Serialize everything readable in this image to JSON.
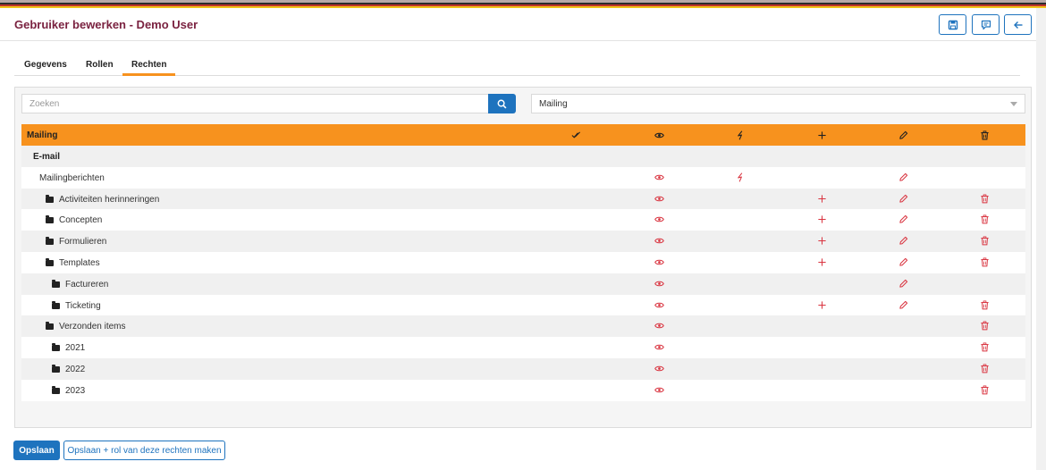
{
  "header": {
    "title": "Gebruiker bewerken - Demo User",
    "buttons": [
      {
        "icon": "save-icon"
      },
      {
        "icon": "comment-icon"
      },
      {
        "icon": "arrow-left-icon"
      }
    ]
  },
  "tabs": [
    {
      "label": "Gegevens",
      "active": false
    },
    {
      "label": "Rollen",
      "active": false
    },
    {
      "label": "Rechten",
      "active": true
    }
  ],
  "search": {
    "placeholder": "Zoeken",
    "value": ""
  },
  "filter_select": {
    "value": "Mailing"
  },
  "table": {
    "header_label": "Mailing",
    "header_icons": [
      "check-double-icon",
      "eye-icon",
      "lightning-icon",
      "plus-icon",
      "pencil-icon",
      "trash-icon"
    ],
    "section_label": "E-mail",
    "rows": [
      {
        "label": "Mailingberichten",
        "indent": 0,
        "folder": false,
        "eye": true,
        "lightning": true,
        "plus": false,
        "pencil": true,
        "trash": false
      },
      {
        "label": "Activiteiten herinneringen",
        "indent": 1,
        "folder": true,
        "eye": true,
        "lightning": false,
        "plus": true,
        "pencil": true,
        "trash": true
      },
      {
        "label": "Concepten",
        "indent": 1,
        "folder": true,
        "eye": true,
        "lightning": false,
        "plus": true,
        "pencil": true,
        "trash": true
      },
      {
        "label": "Formulieren",
        "indent": 1,
        "folder": true,
        "eye": true,
        "lightning": false,
        "plus": true,
        "pencil": true,
        "trash": true
      },
      {
        "label": "Templates",
        "indent": 1,
        "folder": true,
        "eye": true,
        "lightning": false,
        "plus": true,
        "pencil": true,
        "trash": true
      },
      {
        "label": "Factureren",
        "indent": 2,
        "folder": true,
        "eye": true,
        "lightning": false,
        "plus": false,
        "pencil": true,
        "trash": false
      },
      {
        "label": "Ticketing",
        "indent": 2,
        "folder": true,
        "eye": true,
        "lightning": false,
        "plus": true,
        "pencil": true,
        "trash": true
      },
      {
        "label": "Verzonden items",
        "indent": 1,
        "folder": true,
        "eye": true,
        "lightning": false,
        "plus": false,
        "pencil": false,
        "trash": true
      },
      {
        "label": "2021",
        "indent": 2,
        "folder": true,
        "eye": true,
        "lightning": false,
        "plus": false,
        "pencil": false,
        "trash": true
      },
      {
        "label": "2022",
        "indent": 2,
        "folder": true,
        "eye": true,
        "lightning": false,
        "plus": false,
        "pencil": false,
        "trash": true
      },
      {
        "label": "2023",
        "indent": 2,
        "folder": true,
        "eye": true,
        "lightning": false,
        "plus": false,
        "pencil": false,
        "trash": true
      }
    ]
  },
  "footer": {
    "save_label": "Opslaan",
    "save_role_label": "Opslaan + rol van deze rechten maken"
  },
  "colors": {
    "accent_orange": "#f7921e",
    "primary_blue": "#1e73be",
    "title_color": "#7a2240",
    "icon_red": "#d9333f"
  }
}
